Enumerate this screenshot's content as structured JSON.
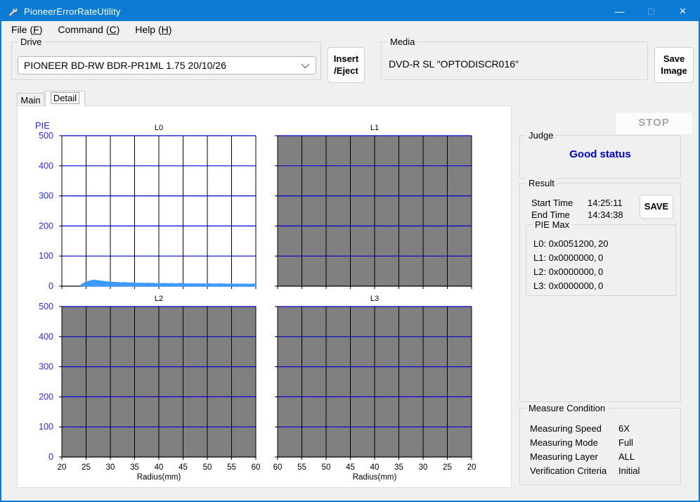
{
  "window": {
    "title": "PioneerErrorRateUtility",
    "controls": {
      "minimize": "—",
      "maximize": "□",
      "close": "×"
    }
  },
  "menu": {
    "file": {
      "prefix": "File (",
      "key": "F",
      "suffix": ")"
    },
    "command": {
      "prefix": "Command (",
      "key": "C",
      "suffix": ")"
    },
    "help": {
      "prefix": "Help (",
      "key": "H",
      "suffix": ")"
    }
  },
  "drive": {
    "label": "Drive",
    "value": "PIONEER BD-RW BDR-PR1ML 1.75 20/10/26"
  },
  "insert_eject": {
    "line1": "Insert",
    "line2": "/Eject"
  },
  "media": {
    "label": "Media",
    "value": "DVD-R SL \"OPTODISCR016\""
  },
  "save_image": {
    "line1": "Save",
    "line2": "Image"
  },
  "tabs": [
    {
      "label": "Main"
    },
    {
      "label": "Detail"
    }
  ],
  "stop_button": {
    "label": "STOP"
  },
  "judge": {
    "label": "Judge",
    "status": "Good status"
  },
  "result": {
    "label": "Result",
    "start_time_label": "Start Time",
    "start_time": "14:25:11",
    "end_time_label": "End Time",
    "end_time": "14:34:38",
    "save_label": "SAVE",
    "pie_max": {
      "label": "PIE Max",
      "rows": [
        {
          "hex": "L0: 0x0051200,",
          "count": "20"
        },
        {
          "hex": "L1: 0x0000000,",
          "count": "0"
        },
        {
          "hex": "L2: 0x0000000,",
          "count": "0"
        },
        {
          "hex": "L3: 0x0000000,",
          "count": "0"
        }
      ]
    }
  },
  "measure_condition": {
    "label": "Measure Condition",
    "rows": [
      {
        "label": "Measuring Speed",
        "value": "6X"
      },
      {
        "label": "Measuring Mode",
        "value": "Full"
      },
      {
        "label": "Measuring Layer",
        "value": "ALL"
      },
      {
        "label": "Verification Criteria",
        "value": "Initial"
      }
    ]
  },
  "chart_data": {
    "type": "area",
    "axis_label": "PIE",
    "ylim": [
      0,
      500
    ],
    "yticks": [
      0,
      100,
      200,
      300,
      400,
      500
    ],
    "colors": {
      "grid_blue": "#0000d2",
      "grid_black": "#000000",
      "trace": "#3e9aff",
      "axis_text": "#2a2af0",
      "disabled_bg": "#808080",
      "enabled_bg": "#ffffff"
    },
    "charts": [
      {
        "title": "L0",
        "enabled": true,
        "xlim": [
          20,
          60
        ],
        "x_ticks": [],
        "xlabel": "",
        "show_y_labels": true,
        "series": {
          "x_start": 24,
          "x_step": 0.5,
          "values": [
            5,
            9,
            13,
            16,
            18,
            20,
            19,
            18,
            17,
            16,
            15,
            14,
            13,
            13,
            12,
            12,
            11,
            11,
            12,
            11,
            10,
            11,
            10,
            10,
            9,
            10,
            9,
            9,
            10,
            9,
            9,
            8,
            9,
            8,
            9,
            8,
            8,
            9,
            8,
            8,
            8,
            9,
            8,
            8,
            7,
            8,
            8,
            7,
            8,
            7,
            8,
            7,
            7,
            8,
            7,
            7,
            7,
            8,
            7,
            7,
            6,
            7,
            7,
            6,
            7,
            6,
            7,
            6,
            7,
            6,
            6,
            7,
            6
          ]
        }
      },
      {
        "title": "L1",
        "enabled": false,
        "xlim": [
          20,
          60
        ],
        "x_ticks": [],
        "xlabel": "",
        "show_y_labels": false
      },
      {
        "title": "L2",
        "enabled": false,
        "xlim": [
          20,
          60
        ],
        "x_ticks": [
          20,
          25,
          30,
          35,
          40,
          45,
          50,
          55,
          60
        ],
        "xlabel": "Radius(mm)",
        "show_y_labels": true
      },
      {
        "title": "L3",
        "enabled": false,
        "xlim": [
          60,
          20
        ],
        "x_ticks": [
          60,
          55,
          50,
          45,
          40,
          35,
          30,
          25,
          20
        ],
        "xlabel": "Radius(mm)",
        "show_y_labels": false
      }
    ]
  }
}
